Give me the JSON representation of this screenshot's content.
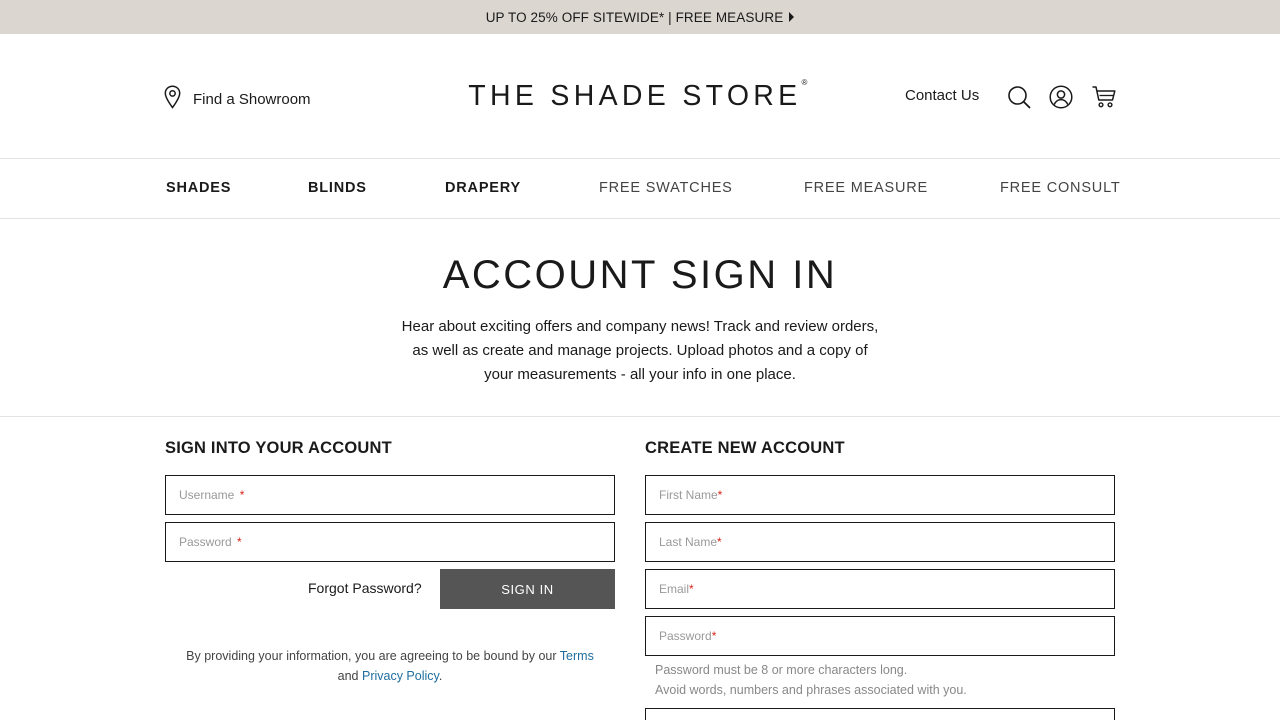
{
  "promo": {
    "text": "UP TO 25% OFF SITEWIDE* | FREE MEASURE"
  },
  "header": {
    "showroom_label": "Find a Showroom",
    "logo_text": "THE SHADE STORE",
    "logo_mark": "®",
    "contact_label": "Contact Us",
    "icons": [
      "map-pin-icon",
      "search-icon",
      "account-icon",
      "cart-icon"
    ]
  },
  "nav": {
    "items": [
      {
        "label": "SHADES"
      },
      {
        "label": "BLINDS"
      },
      {
        "label": "DRAPERY"
      },
      {
        "label": "FREE SWATCHES"
      },
      {
        "label": "FREE MEASURE"
      },
      {
        "label": "FREE CONSULT"
      }
    ]
  },
  "hero": {
    "title": "ACCOUNT SIGN IN",
    "description": "Hear about exciting offers and company news! Track and review orders, as well as create and manage projects. Upload photos and a copy of your measurements - all your info in one place."
  },
  "signin": {
    "title": "SIGN INTO YOUR ACCOUNT",
    "username_placeholder": "Username",
    "password_placeholder": "Password",
    "required_mark": "*",
    "forgot_label": "Forgot Password?",
    "button_label": "SIGN IN",
    "legal_prefix": "By providing your information, you are agreeing to be bound by our",
    "terms_label": "Terms",
    "and_label": "and",
    "privacy_label": "Privacy Policy",
    "period": "."
  },
  "create": {
    "title": "CREATE NEW ACCOUNT",
    "first_name_placeholder": "First Name",
    "last_name_placeholder": "Last Name",
    "email_placeholder": "Email",
    "password_placeholder": "Password",
    "hint_1": "Password must be 8 or more characters long.",
    "hint_2": "Avoid words, numbers and phrases associated with you."
  },
  "colors": {
    "promo_bg": "#dcd6d0",
    "button_bg": "#555555",
    "link": "#1f6e9e",
    "required": "#d9241b"
  }
}
